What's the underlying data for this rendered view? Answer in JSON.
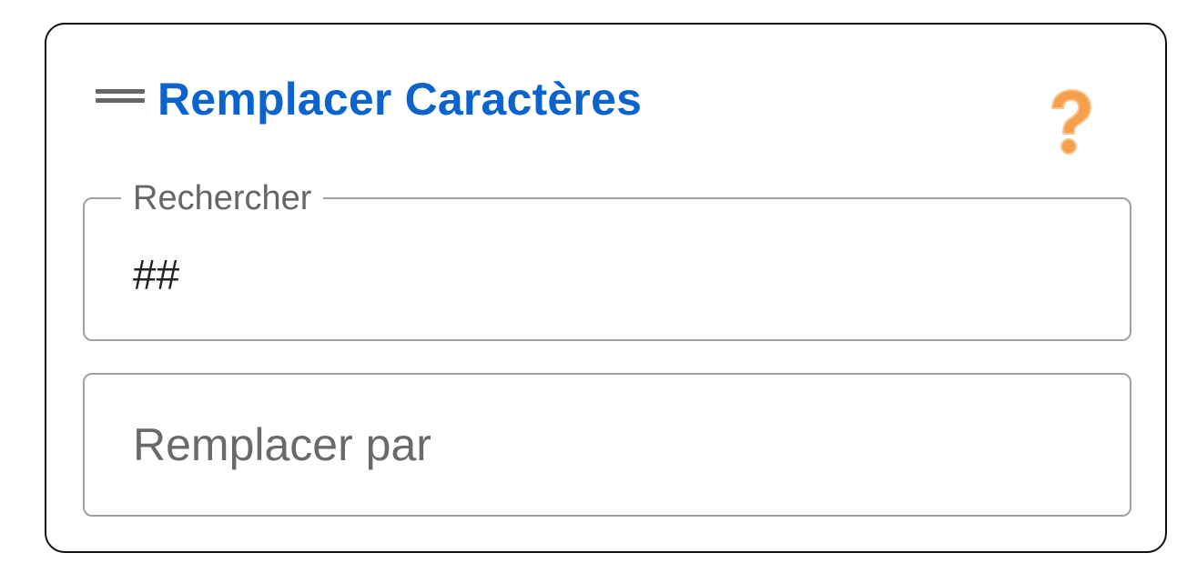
{
  "widget": {
    "title": "Remplacer Caractères",
    "drag_icon": "drag-handle-icon",
    "help_icon": "question-mark-icon"
  },
  "search_field": {
    "label": "Rechercher",
    "value": "##"
  },
  "replace_field": {
    "placeholder": "Remplacer par",
    "value": ""
  },
  "colors": {
    "title": "#0b63ce",
    "help_icon": "#f5a04a",
    "border": "#111111",
    "field_border": "#a0a0a0"
  }
}
